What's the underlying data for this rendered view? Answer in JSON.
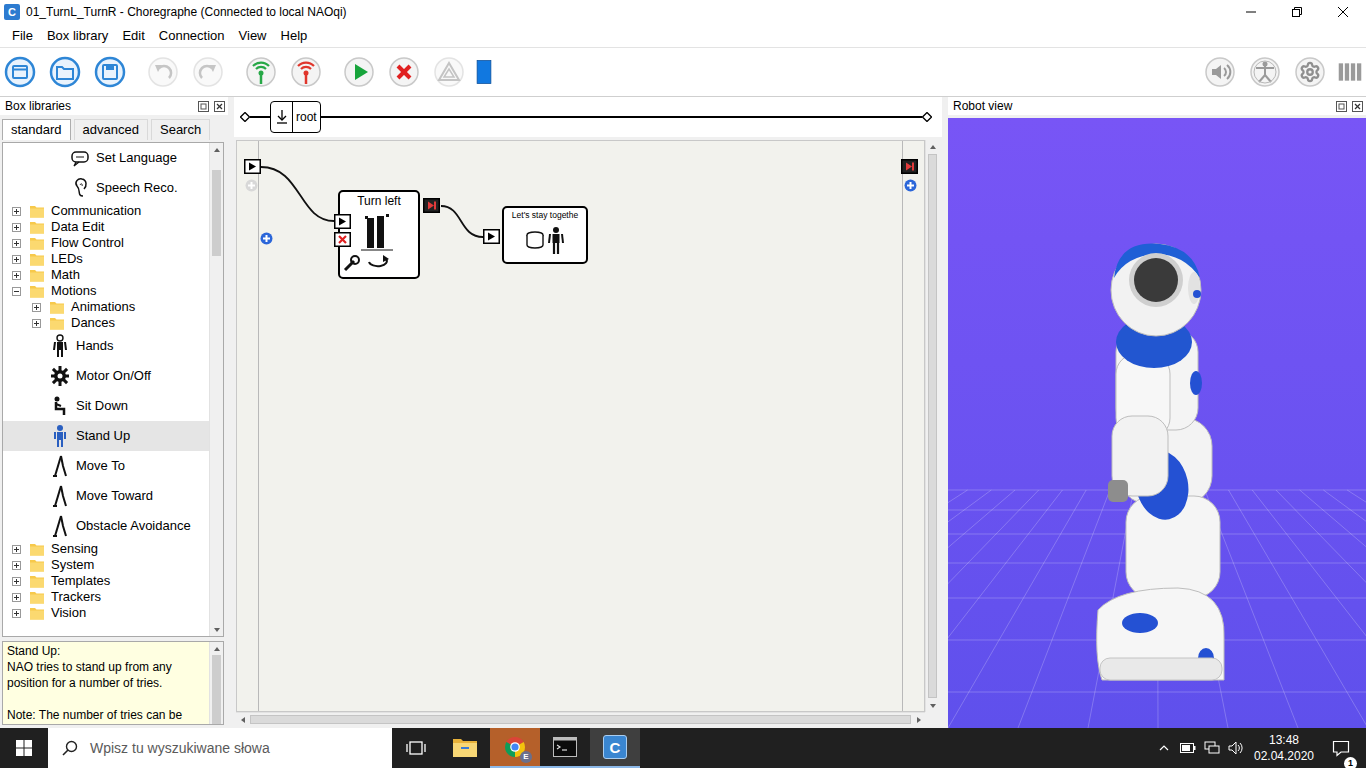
{
  "window": {
    "title": "01_TurnL_TurnR - Choregraphe (Connected to local NAOqi)",
    "icon_letter": "C"
  },
  "menu": [
    "File",
    "Box library",
    "Edit",
    "Connection",
    "View",
    "Help"
  ],
  "toolbar": [
    {
      "kind": "new",
      "disabled": false
    },
    {
      "kind": "open",
      "disabled": false
    },
    {
      "kind": "save",
      "disabled": false
    },
    {
      "kind": "undo",
      "disabled": true
    },
    {
      "kind": "redo",
      "disabled": true
    },
    {
      "kind": "connect",
      "disabled": false
    },
    {
      "kind": "disconnect",
      "disabled": false
    },
    {
      "kind": "play",
      "disabled": false
    },
    {
      "kind": "stop",
      "disabled": false
    },
    {
      "kind": "debug",
      "disabled": true
    },
    {
      "kind": "view",
      "disabled": false
    }
  ],
  "status_tools": [
    {
      "kind": "volume"
    },
    {
      "kind": "posture"
    },
    {
      "kind": "motors"
    },
    {
      "kind": "battery"
    }
  ],
  "box_libraries": {
    "title": "Box libraries",
    "tabs": [
      {
        "label": "standard",
        "selected": true
      },
      {
        "label": "advanced",
        "selected": false
      },
      {
        "label": "Search",
        "selected": false
      }
    ],
    "scroll_level": 0.03,
    "items": [
      {
        "label": "Set Language",
        "kind": "language",
        "depth": 2,
        "selected": false
      },
      {
        "label": "Speech Reco.",
        "kind": "speech",
        "depth": 2,
        "selected": false
      },
      {
        "label": "Communication",
        "kind": "folder",
        "depth": 0,
        "expanded": false,
        "selected": false
      },
      {
        "label": "Data Edit",
        "kind": "folder",
        "depth": 0,
        "expanded": false,
        "selected": false
      },
      {
        "label": "Flow Control",
        "kind": "folder",
        "depth": 0,
        "expanded": false,
        "selected": false
      },
      {
        "label": "LEDs",
        "kind": "folder",
        "depth": 0,
        "expanded": false,
        "selected": false
      },
      {
        "label": "Math",
        "kind": "folder",
        "depth": 0,
        "expanded": false,
        "selected": false
      },
      {
        "label": "Motions",
        "kind": "folder",
        "depth": 0,
        "expanded": true,
        "selected": false
      },
      {
        "label": "Animations",
        "kind": "folder",
        "depth": 1,
        "expanded": false,
        "selected": false
      },
      {
        "label": "Dances",
        "kind": "folder",
        "depth": 1,
        "expanded": false,
        "selected": false
      },
      {
        "label": "Hands",
        "kind": "hands",
        "depth": 1,
        "selected": false
      },
      {
        "label": "Motor On/Off",
        "kind": "motor",
        "depth": 1,
        "selected": false
      },
      {
        "label": "Sit Down",
        "kind": "sit",
        "depth": 1,
        "selected": false
      },
      {
        "label": "Stand Up",
        "kind": "stand",
        "depth": 1,
        "selected": true
      },
      {
        "label": "Move To",
        "kind": "walk",
        "depth": 1,
        "selected": false
      },
      {
        "label": "Move Toward",
        "kind": "walk",
        "depth": 1,
        "selected": false
      },
      {
        "label": "Obstacle Avoidance",
        "kind": "walk",
        "depth": 1,
        "selected": false
      },
      {
        "label": "Sensing",
        "kind": "folder",
        "depth": 0,
        "expanded": false,
        "selected": false
      },
      {
        "label": "System",
        "kind": "folder",
        "depth": 0,
        "expanded": false,
        "selected": false
      },
      {
        "label": "Templates",
        "kind": "folder",
        "depth": 0,
        "expanded": false,
        "selected": false
      },
      {
        "label": "Trackers",
        "kind": "folder",
        "depth": 0,
        "expanded": false,
        "selected": false
      },
      {
        "label": "Vision",
        "kind": "folder",
        "depth": 0,
        "expanded": false,
        "selected": false
      }
    ]
  },
  "description": {
    "scroll_level": 0,
    "lines": [
      "Stand Up:",
      "NAO tries to stand up from any",
      "position for a number of tries.",
      "",
      "Note: The number of tries can be"
    ]
  },
  "flow": {
    "breadcrumb": "root",
    "nodes": [
      {
        "title": "Turn left",
        "kind": "walk"
      },
      {
        "title": "Let's stay togethe",
        "kind": "dialog"
      }
    ]
  },
  "robot_view": {
    "title": "Robot view"
  },
  "taskbar": {
    "search_placeholder": "Wpisz tu wyszukiwane słowa",
    "apps": [
      {
        "kind": "explorer",
        "selected": false,
        "running": false,
        "flashing": false
      },
      {
        "kind": "chrome",
        "label": "E",
        "selected": false,
        "running": true,
        "flashing": true
      },
      {
        "kind": "cmd",
        "selected": false,
        "running": true,
        "flashing": false
      },
      {
        "kind": "choregraphe",
        "label": "C",
        "selected": true,
        "running": true,
        "flashing": false
      }
    ],
    "time": "13:48",
    "date": "02.04.2020",
    "notifications": "1"
  }
}
